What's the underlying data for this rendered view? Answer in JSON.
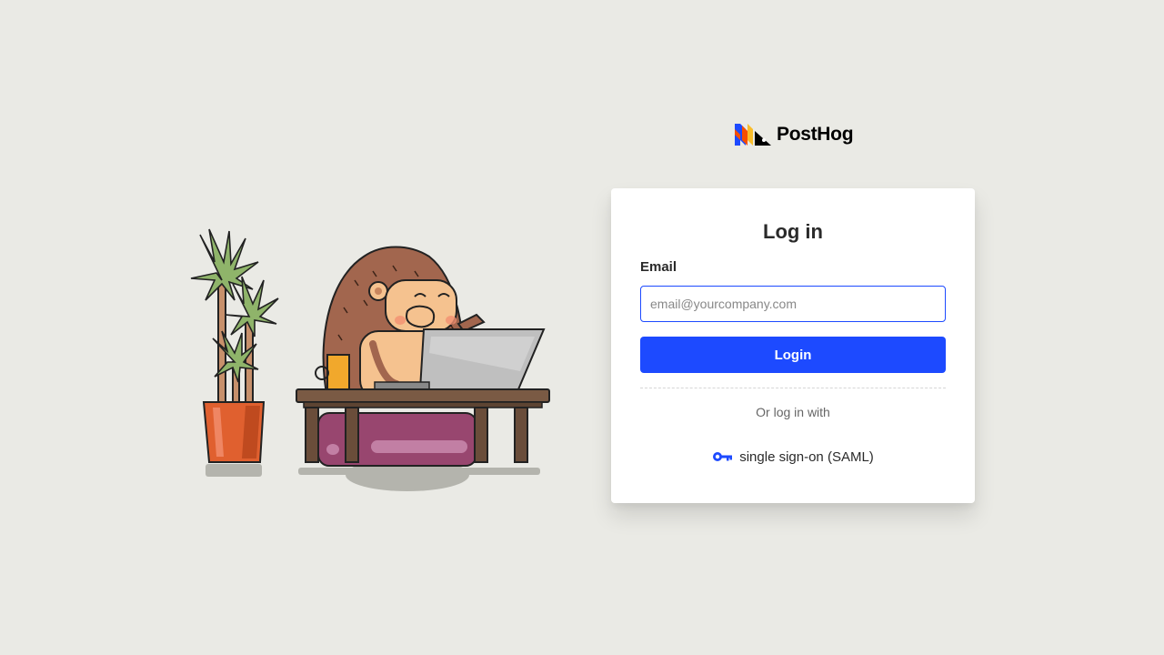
{
  "brand": {
    "name": "PostHog",
    "colors": {
      "blue": "#1d4aff",
      "orange": "#f54e00",
      "yellow": "#f9bd2b",
      "black": "#000000"
    }
  },
  "illustration": {
    "description_icon": "hedgehog-at-laptop-illustration"
  },
  "login": {
    "title": "Log in",
    "email_label": "Email",
    "email_placeholder": "email@yourcompany.com",
    "email_value": "",
    "submit_label": "Login",
    "alt_prompt": "Or log in with",
    "sso_label": "single sign-on (SAML)",
    "sso_icon": "key-icon"
  },
  "theme": {
    "background": "#eaeae5",
    "accent": "#1d4aff"
  }
}
